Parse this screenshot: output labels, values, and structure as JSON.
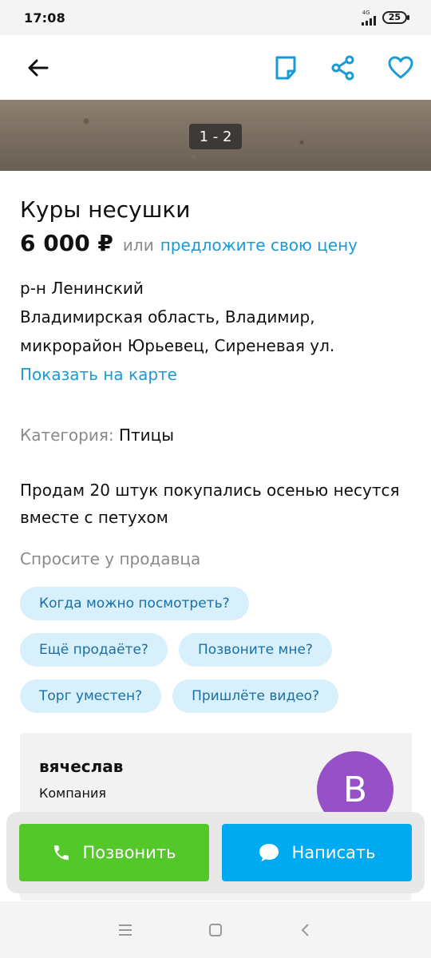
{
  "status_bar": {
    "time": "17:08",
    "network": "4G",
    "battery": "25"
  },
  "photo": {
    "counter": "1 - 2"
  },
  "listing": {
    "title": "Куры несушки",
    "price": "6 000 ₽",
    "price_or": "или",
    "offer_price_link": "предложите свою цену",
    "district": "р-н Ленинский",
    "address_line1": "Владимирская область, Владимир,",
    "address_line2": "микрорайон Юрьевец, Сиреневая ул.",
    "show_on_map": "Показать на карте",
    "category_label": "Категория:",
    "category_value": "Птицы",
    "description_line1": "Продам 20 штук покупались осенью несутся",
    "description_line2": "вместе с петухом"
  },
  "ask_seller": {
    "title": "Спросите у продавца",
    "chips": [
      "Когда можно посмотреть?",
      "Ещё продаёте?",
      "Позвоните мне?",
      "Торг уместен?",
      "Пришлёте видео?"
    ]
  },
  "seller": {
    "name": "вячеслав",
    "type": "Компания",
    "avatar_letter": "В"
  },
  "actions": {
    "call": "Позвонить",
    "write": "Написать"
  },
  "colors": {
    "accent": "#1a9ad6",
    "call": "#54c82a",
    "write": "#00aaf1",
    "avatar": "#9650c8",
    "chip_bg": "#d7f0fc"
  },
  "icons": [
    "back-arrow-icon",
    "note-icon",
    "share-icon",
    "heart-icon",
    "phone-icon",
    "chat-bubble-icon",
    "menu-icon",
    "home-square-icon",
    "back-chevron-icon"
  ]
}
